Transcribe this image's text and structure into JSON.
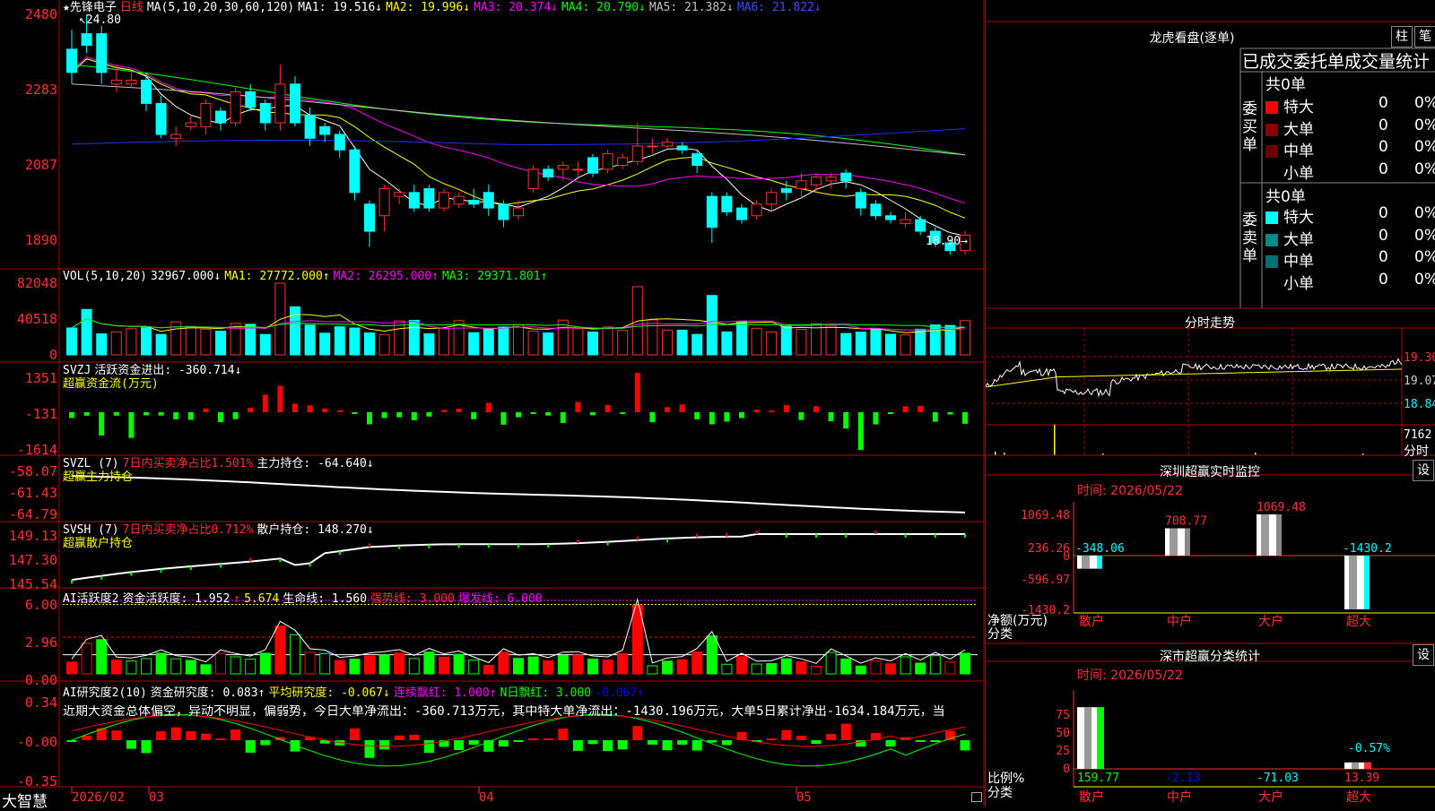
{
  "title_bar": {
    "stock_name": "★先锋电子",
    "period": "日线",
    "ma_params": "MA(5,10,20,30,60,120)"
  },
  "price_pane": {
    "ma_values": [
      {
        "label": "MA1: 19.516↓",
        "color": "#ffffff"
      },
      {
        "label": "MA2: 19.996↓",
        "color": "#ffff00"
      },
      {
        "label": "MA3: 20.374↓",
        "color": "#ff00ff"
      },
      {
        "label": "MA4: 20.790↓",
        "color": "#00ff00"
      },
      {
        "label": "MA5: 21.382↓",
        "color": "#c0c0c0"
      },
      {
        "label": "MA6: 21.822↓",
        "color": "#0000ff"
      }
    ],
    "y_ticks": [
      "2480",
      "2283",
      "2087",
      "1890"
    ],
    "high_mark": "24.80",
    "low_mark": "18.90→",
    "candles": [
      {
        "o": 23.9,
        "c": 23.3,
        "h": 24.4,
        "l": 23.0
      },
      {
        "o": 24.3,
        "c": 24.0,
        "h": 24.8,
        "l": 23.8
      },
      {
        "o": 24.3,
        "c": 23.3,
        "h": 24.5,
        "l": 23.0
      },
      {
        "o": 23.0,
        "c": 23.1,
        "h": 23.5,
        "l": 22.8
      },
      {
        "o": 23.0,
        "c": 23.1,
        "h": 23.3,
        "l": 22.9
      },
      {
        "o": 23.1,
        "c": 22.5,
        "h": 23.3,
        "l": 22.3
      },
      {
        "o": 22.5,
        "c": 21.7,
        "h": 22.7,
        "l": 21.6
      },
      {
        "o": 21.6,
        "c": 21.7,
        "h": 21.9,
        "l": 21.4
      },
      {
        "o": 21.9,
        "c": 22.0,
        "h": 22.2,
        "l": 21.8
      },
      {
        "o": 21.9,
        "c": 22.5,
        "h": 22.6,
        "l": 21.7
      },
      {
        "o": 22.3,
        "c": 22.0,
        "h": 22.4,
        "l": 21.8
      },
      {
        "o": 22.0,
        "c": 22.8,
        "h": 22.9,
        "l": 21.9
      },
      {
        "o": 22.8,
        "c": 22.4,
        "h": 23.0,
        "l": 22.3
      },
      {
        "o": 22.5,
        "c": 22.0,
        "h": 22.6,
        "l": 21.8
      },
      {
        "o": 22.0,
        "c": 23.0,
        "h": 23.5,
        "l": 21.8
      },
      {
        "o": 23.0,
        "c": 22.0,
        "h": 23.2,
        "l": 21.9
      },
      {
        "o": 22.2,
        "c": 21.6,
        "h": 22.4,
        "l": 21.4
      },
      {
        "o": 21.9,
        "c": 21.7,
        "h": 22.0,
        "l": 21.5
      },
      {
        "o": 21.7,
        "c": 21.3,
        "h": 21.8,
        "l": 21.1
      },
      {
        "o": 21.3,
        "c": 20.2,
        "h": 21.4,
        "l": 20.0
      },
      {
        "o": 19.9,
        "c": 19.2,
        "h": 20.0,
        "l": 18.8
      },
      {
        "o": 19.6,
        "c": 20.3,
        "h": 20.4,
        "l": 19.2
      },
      {
        "o": 20.1,
        "c": 20.2,
        "h": 20.3,
        "l": 19.9
      },
      {
        "o": 20.2,
        "c": 19.8,
        "h": 20.4,
        "l": 19.7
      },
      {
        "o": 20.3,
        "c": 19.8,
        "h": 20.4,
        "l": 19.7
      },
      {
        "o": 19.8,
        "c": 20.2,
        "h": 20.3,
        "l": 19.7
      },
      {
        "o": 19.9,
        "c": 20.1,
        "h": 20.2,
        "l": 19.8
      },
      {
        "o": 20.0,
        "c": 19.9,
        "h": 20.3,
        "l": 19.8
      },
      {
        "o": 20.2,
        "c": 19.8,
        "h": 20.4,
        "l": 19.6
      },
      {
        "o": 19.9,
        "c": 19.5,
        "h": 20.0,
        "l": 19.3
      },
      {
        "o": 19.6,
        "c": 19.8,
        "h": 20.0,
        "l": 19.5
      },
      {
        "o": 20.3,
        "c": 20.8,
        "h": 20.9,
        "l": 20.2
      },
      {
        "o": 20.8,
        "c": 20.6,
        "h": 20.9,
        "l": 20.5
      },
      {
        "o": 20.8,
        "c": 20.9,
        "h": 21.0,
        "l": 20.5
      },
      {
        "o": 20.8,
        "c": 20.8,
        "h": 21.0,
        "l": 20.6
      },
      {
        "o": 21.1,
        "c": 20.7,
        "h": 21.2,
        "l": 20.6
      },
      {
        "o": 20.8,
        "c": 21.2,
        "h": 21.3,
        "l": 20.7
      },
      {
        "o": 20.9,
        "c": 21.1,
        "h": 21.2,
        "l": 20.8
      },
      {
        "o": 21.0,
        "c": 21.4,
        "h": 22.0,
        "l": 20.9
      },
      {
        "o": 21.4,
        "c": 21.4,
        "h": 21.6,
        "l": 21.2
      },
      {
        "o": 21.4,
        "c": 21.5,
        "h": 21.6,
        "l": 21.3
      },
      {
        "o": 21.4,
        "c": 21.3,
        "h": 21.5,
        "l": 21.2
      },
      {
        "o": 21.2,
        "c": 20.9,
        "h": 21.3,
        "l": 20.7
      },
      {
        "o": 20.1,
        "c": 19.3,
        "h": 20.2,
        "l": 18.9
      },
      {
        "o": 20.1,
        "c": 19.7,
        "h": 20.2,
        "l": 19.6
      },
      {
        "o": 19.8,
        "c": 19.5,
        "h": 19.9,
        "l": 19.4
      },
      {
        "o": 19.6,
        "c": 19.9,
        "h": 20.0,
        "l": 19.5
      },
      {
        "o": 19.9,
        "c": 20.2,
        "h": 20.3,
        "l": 19.7
      },
      {
        "o": 20.3,
        "c": 20.2,
        "h": 20.5,
        "l": 20.0
      },
      {
        "o": 20.3,
        "c": 20.5,
        "h": 20.7,
        "l": 20.1
      },
      {
        "o": 20.4,
        "c": 20.6,
        "h": 20.7,
        "l": 20.2
      },
      {
        "o": 20.5,
        "c": 20.6,
        "h": 20.7,
        "l": 20.3
      },
      {
        "o": 20.7,
        "c": 20.5,
        "h": 20.8,
        "l": 20.3
      },
      {
        "o": 20.2,
        "c": 19.8,
        "h": 20.3,
        "l": 19.6
      },
      {
        "o": 19.9,
        "c": 19.6,
        "h": 20.0,
        "l": 19.5
      },
      {
        "o": 19.6,
        "c": 19.5,
        "h": 19.7,
        "l": 19.4
      },
      {
        "o": 19.4,
        "c": 19.5,
        "h": 19.7,
        "l": 19.3
      },
      {
        "o": 19.5,
        "c": 19.2,
        "h": 19.6,
        "l": 19.1
      },
      {
        "o": 19.2,
        "c": 18.9,
        "h": 19.3,
        "l": 18.8
      },
      {
        "o": 18.9,
        "c": 18.7,
        "h": 19.0,
        "l": 18.6
      },
      {
        "o": 18.7,
        "c": 19.1,
        "h": 19.2,
        "l": 18.6
      }
    ]
  },
  "vol_pane": {
    "label": "VOL(5,10,20)",
    "value": "32967.000↓",
    "ma1": "MA1: 27772.000↑",
    "ma2": "MA2: 26295.000↑",
    "ma3": "MA3: 29371.801↑",
    "y_ticks": [
      "82048",
      "40518",
      "0"
    ]
  },
  "svzj_pane": {
    "label": "SVZJ",
    "value": "活跃资金进出: -360.714↓",
    "sub": "超赢资金流(万元)",
    "y_ticks": [
      "1351",
      "-131",
      "-1614"
    ]
  },
  "svzl_pane": {
    "label": "SVZL (7)",
    "ratio": "7日内买卖净占比1.501%",
    "main": "主力持仓: -64.640↓",
    "sub": "超赢主力持仓",
    "y_ticks": [
      "-58.07",
      "-61.43",
      "-64.79"
    ]
  },
  "svsh_pane": {
    "label": "SVSH (7)",
    "ratio": "7日内买卖净占比0.712%",
    "main": "散户持仓: 148.270↓",
    "sub": "超赢散户持仓",
    "y_ticks": [
      "149.13",
      "147.30",
      "145.54"
    ]
  },
  "ai1_pane": {
    "label": "AI活跃度2",
    "v1": "资金活跃度: 1.952",
    "v2": "5.674",
    "v3": "生命线: 1.560",
    "v4": "强势线: 3.000",
    "v5": "爆发线: 6.000",
    "y_ticks": [
      "6.00",
      "2.96",
      "0.00"
    ]
  },
  "ai2_pane": {
    "label": "AI研究度2(10)",
    "v1": "资金研究度: 0.083↑",
    "v2": "平均研究度: -0.067↓",
    "v3": "连续飘红: 1.000↑",
    "v4": "N日飘红: 3.000",
    "v5": "-0.067↑",
    "comment": "近期大资金总体偏空，异动不明显，偏弱势，今日大单净流出：-360.713万元，其中特大单净流出：-1430.196万元，大单5日累计净出-1634.184万元，当",
    "y_ticks": [
      "0.34",
      "-0.00",
      "-0.35"
    ]
  },
  "x_axis": {
    "brand": "大智慧",
    "labels": [
      "2026/02",
      "03",
      "04",
      "05"
    ]
  },
  "dragon_tiger": {
    "title": "龙虎看盘(逐单)",
    "btn_bar": "柱",
    "btn_pen": "笔",
    "tabs": "已成交委托单成交量统计",
    "buy_header": "共0单",
    "sell_header": "共0单",
    "buy_side": "委买单",
    "sell_side": "委卖单",
    "rows_buy": [
      {
        "label": "特大",
        "count": "0",
        "pct": "0%",
        "color": "#ff0000"
      },
      {
        "label": "大单",
        "count": "0",
        "pct": "0%",
        "color": "#8b0000"
      },
      {
        "label": "中单",
        "count": "0",
        "pct": "0%",
        "color": "#6b0000"
      },
      {
        "label": "小单",
        "count": "0",
        "pct": "0%",
        "color": ""
      }
    ],
    "rows_sell": [
      {
        "label": "特大",
        "count": "0",
        "pct": "0%",
        "color": "#00ffff"
      },
      {
        "label": "大单",
        "count": "0",
        "pct": "0%",
        "color": "#008b8b"
      },
      {
        "label": "中单",
        "count": "0",
        "pct": "0%",
        "color": "#007070"
      },
      {
        "label": "小单",
        "count": "0",
        "pct": "0%",
        "color": ""
      }
    ]
  },
  "intraday": {
    "title": "分时走势",
    "y_ticks": [
      "19.30",
      "19.07",
      "18.84"
    ],
    "vol_label": "7162",
    "footer": "分时"
  },
  "sz_monitor": {
    "title": "深圳超赢实时监控",
    "settings": "设",
    "time": "时间: 2026/05/22",
    "y_ticks": [
      "1069.48",
      "236.26",
      "0",
      "-596.97",
      "-1430.2"
    ],
    "y_label": "净额(万元)",
    "x_label": "分类",
    "categories": [
      "散户",
      "中户",
      "大户",
      "超大"
    ],
    "values": [
      -348.06,
      708.77,
      1069.48,
      -1430.2
    ],
    "value_labels": [
      "-348.06",
      "708.77",
      "1069.48",
      "-1430.2"
    ]
  },
  "sz_classify": {
    "title": "深市超赢分类统计",
    "settings": "设",
    "time": "时间: 2026/05/22",
    "y_ticks": [
      "75",
      "50",
      "25",
      "0"
    ],
    "y_label": "比例%",
    "x_label": "分类",
    "categories": [
      "散户",
      "中户",
      "大户",
      "超大"
    ],
    "bottom_values": [
      "159.77",
      "-2.13",
      "-71.03",
      "13.39"
    ],
    "bottom_colors": [
      "#00ff00",
      "#0000ff",
      "#00ffff",
      "#ff3030"
    ],
    "bar_pct": [
      86,
      0,
      0,
      9
    ],
    "bar_label": "-0.57%"
  }
}
